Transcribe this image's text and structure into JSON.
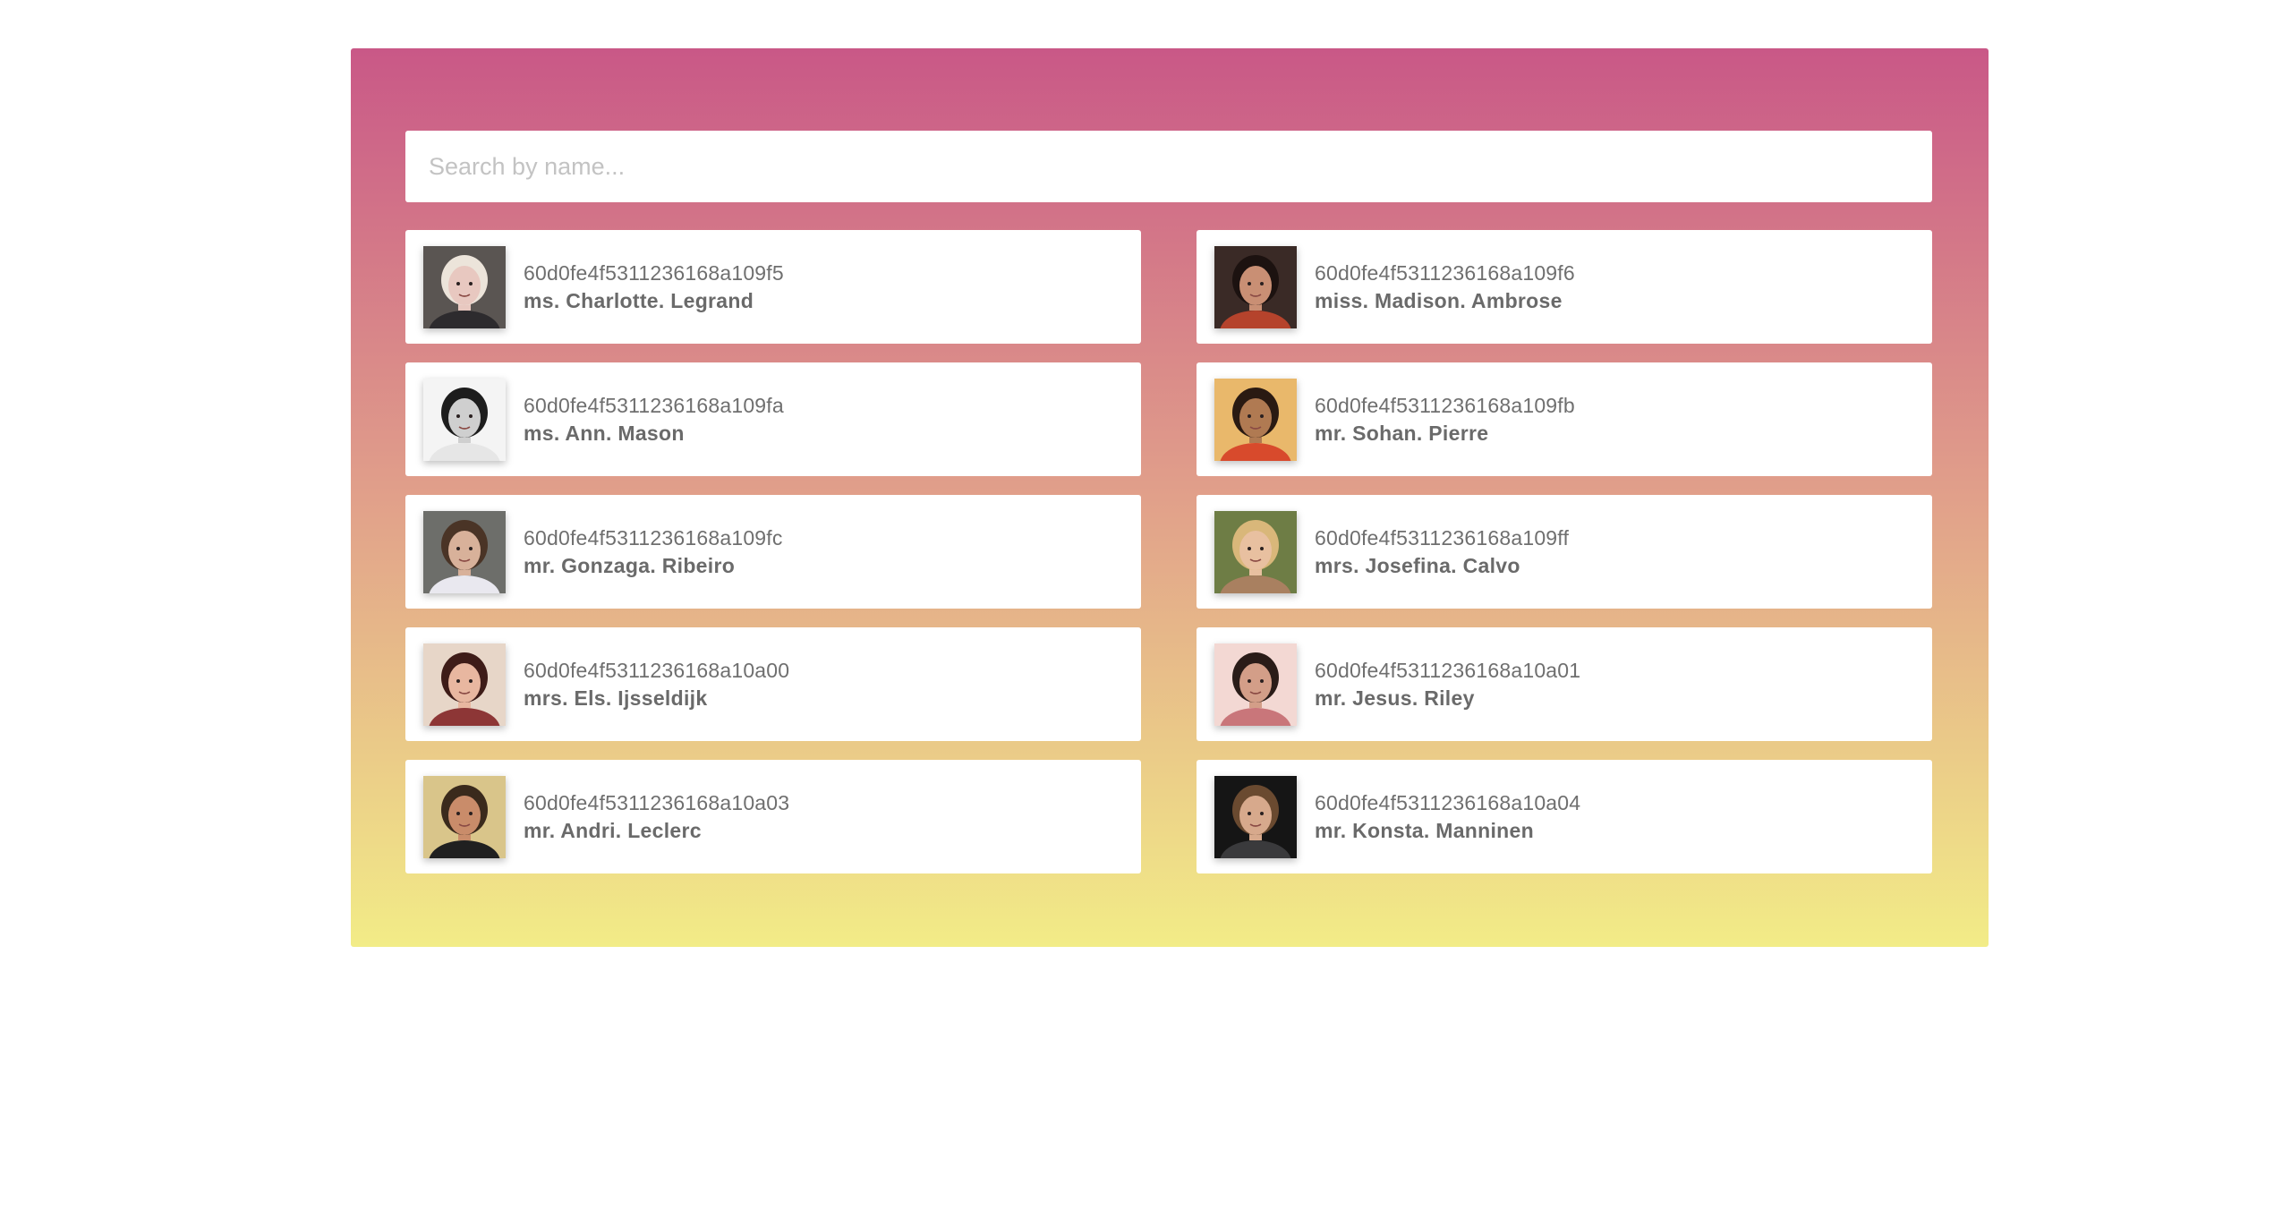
{
  "search": {
    "placeholder": "Search by name...",
    "value": ""
  },
  "users": [
    {
      "id": "60d0fe4f5311236168a109f5",
      "name": "ms. Charlotte. Legrand",
      "avatar": {
        "bg": "#5a5552",
        "face": "#e8c8c0",
        "hair": "#ece4da",
        "shirt": "#2d2b2e"
      }
    },
    {
      "id": "60d0fe4f5311236168a109f6",
      "name": "miss. Madison. Ambrose",
      "avatar": {
        "bg": "#3a2a26",
        "face": "#c98f74",
        "hair": "#1c1210",
        "shirt": "#b5432c"
      }
    },
    {
      "id": "60d0fe4f5311236168a109fa",
      "name": "ms. Ann. Mason",
      "avatar": {
        "bg": "#f4f4f4",
        "face": "#cfcfcf",
        "hair": "#1d1d1d",
        "shirt": "#e6e6e6"
      }
    },
    {
      "id": "60d0fe4f5311236168a109fb",
      "name": "mr. Sohan. Pierre",
      "avatar": {
        "bg": "#e9b86b",
        "face": "#b07a52",
        "hair": "#2a1a12",
        "shirt": "#d84a2c"
      }
    },
    {
      "id": "60d0fe4f5311236168a109fc",
      "name": "mr. Gonzaga. Ribeiro",
      "avatar": {
        "bg": "#6d6e6a",
        "face": "#d8b19a",
        "hair": "#4a3426",
        "shirt": "#e9e8ef"
      }
    },
    {
      "id": "60d0fe4f5311236168a109ff",
      "name": "mrs. Josefina. Calvo",
      "avatar": {
        "bg": "#6e7d45",
        "face": "#e8c0a0",
        "hair": "#d9b77a",
        "shirt": "#a98060"
      }
    },
    {
      "id": "60d0fe4f5311236168a10a00",
      "name": "mrs. Els. Ijsseldijk",
      "avatar": {
        "bg": "#e7d6c8",
        "face": "#e8b7a0",
        "hair": "#3e1c18",
        "shirt": "#8d3636"
      }
    },
    {
      "id": "60d0fe4f5311236168a10a01",
      "name": "mr. Jesus. Riley",
      "avatar": {
        "bg": "#f3d8d3",
        "face": "#d39e88",
        "hair": "#2a1c18",
        "shirt": "#c9767a"
      }
    },
    {
      "id": "60d0fe4f5311236168a10a03",
      "name": "mr. Andri. Leclerc",
      "avatar": {
        "bg": "#d9c58a",
        "face": "#c98c6a",
        "hair": "#3a2a1c",
        "shirt": "#202020"
      }
    },
    {
      "id": "60d0fe4f5311236168a10a04",
      "name": "mr. Konsta. Manninen",
      "avatar": {
        "bg": "#151515",
        "face": "#d7a98c",
        "hair": "#6a4a30",
        "shirt": "#3a3a3c"
      }
    }
  ]
}
